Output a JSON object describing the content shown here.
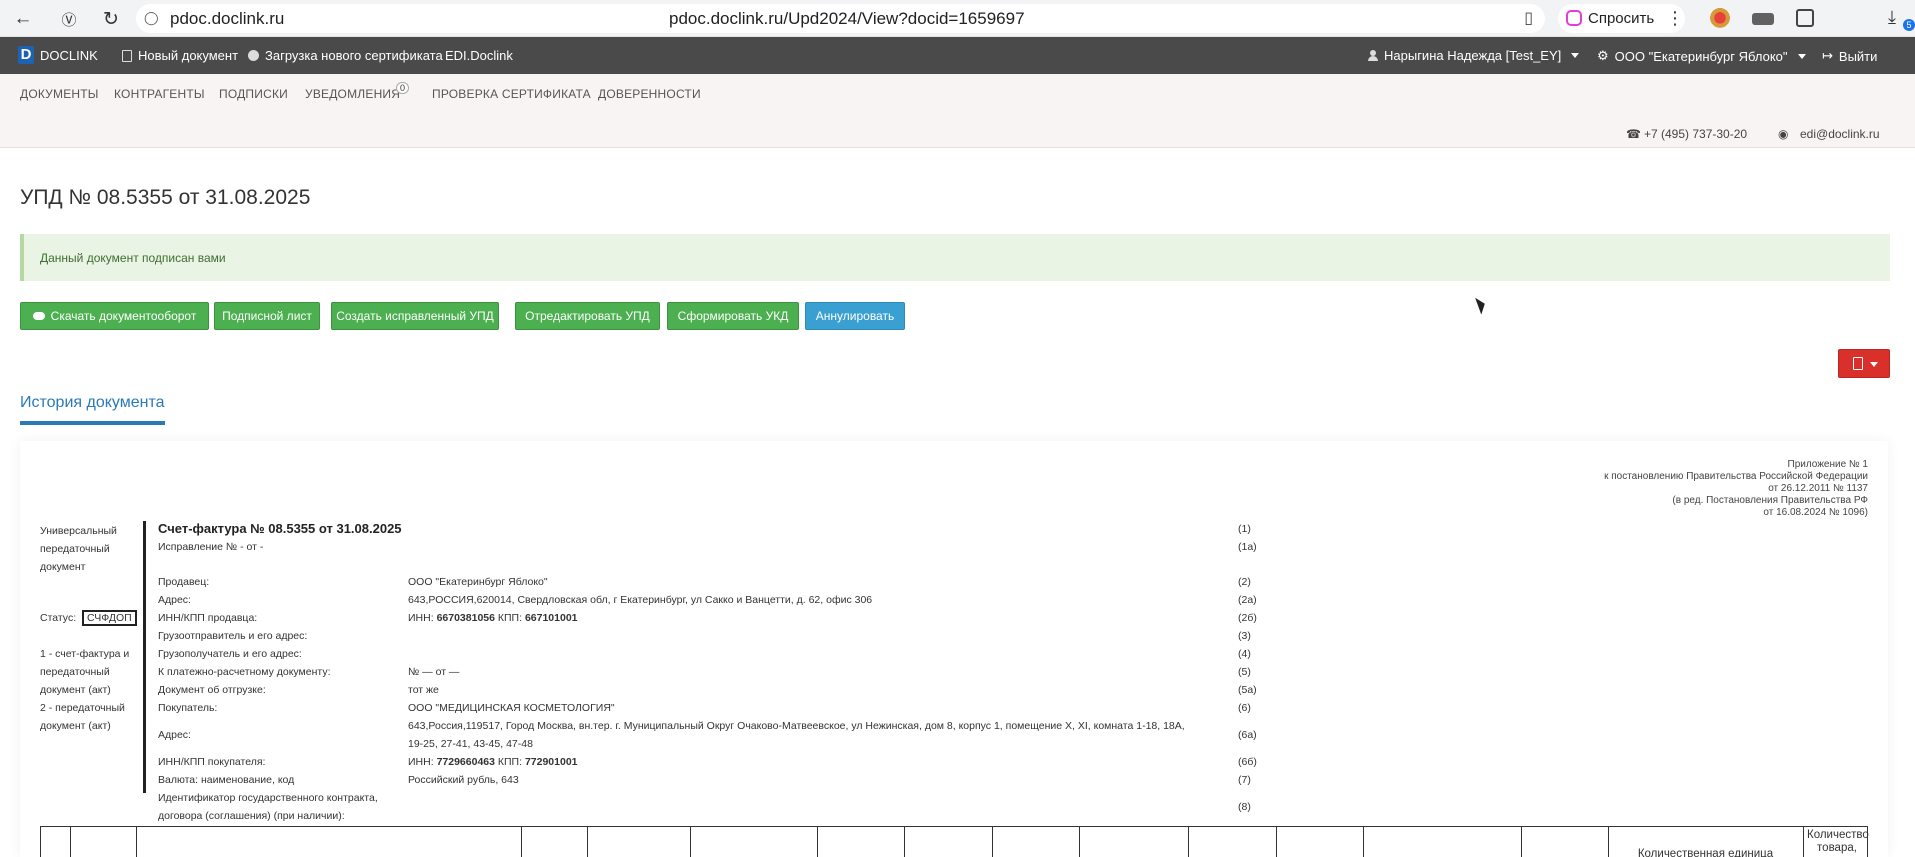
{
  "browser": {
    "host": "pdoc.doclink.ru",
    "url": "pdoc.doclink.ru/Upd2024/View?docid=1659697",
    "ask_label": "Спросить",
    "downloads_badge": "5"
  },
  "topbar": {
    "brand": "DOCLINK",
    "new_doc": "Новый документ",
    "upload_cert": "Загрузка нового сертификата",
    "edi": "EDI.Doclink",
    "user": "Нарыгина Надежда [Test_EY]",
    "org": "ООО \"Екатеринбург Яблоко\"",
    "logout": "Выйти"
  },
  "nav": {
    "items": [
      "ДОКУМЕНТЫ",
      "КОНТРАГЕНТЫ",
      "ПОДПИСКИ",
      "УВЕДОМЛЕНИЯ",
      "ПРОВЕРКА СЕРТИФИКАТА",
      "ДОВЕРЕННОСТИ"
    ],
    "notifications_count": "0",
    "phone": "+7 (495) 737-30-20",
    "email": "edi@doclink.ru"
  },
  "page": {
    "title": "УПД №   08.5355   от   31.08.2025",
    "alert": "Данный документ подписан вами",
    "history_tab": "История документа"
  },
  "actions": {
    "download": "Скачать документооборот",
    "sign_sheet": "Подписной лист",
    "create_corrected": "Создать исправленный УПД",
    "edit": "Отредактировать УПД",
    "form_ukd": "Сформировать УКД",
    "cancel": "Аннулировать"
  },
  "document": {
    "annex": [
      "Приложение № 1",
      "к постановлению Правительства Российской Федерации",
      "от 26.12.2011 № 1137",
      "(в ред. Постановления Правительства РФ",
      "от 16.08.2024 № 1096)"
    ],
    "left_title": "Универсальный передаточный документ",
    "status_label": "Статус:",
    "status_value": "СЧФДОП",
    "legend_1": "1 - счет-фактура и передаточный документ (акт)",
    "legend_2": "2 - передаточный документ (акт)",
    "invoice_title": "Счет-фактура № 08.5355  от 31.08.2025",
    "correction": "Исправление № - от -",
    "rows": {
      "seller_label": "Продавец:",
      "seller": "ООО \"Екатеринбург Яблоко\"",
      "address_label": "Адрес:",
      "seller_address": "643,РОССИЯ,620014, Свердловская обл, г Екатеринбург, ул Сакко и Ванцетти, д. 62, офис 306",
      "seller_inn_label": "ИНН/КПП продавца:",
      "inn_prefix": "ИНН:",
      "seller_inn": "6670381056",
      "kpp_prefix": "КПП:",
      "seller_kpp": "667101001",
      "consignor_label": "Грузоотправитель и его адрес:",
      "consignee_label": "Грузополучатель и его адрес:",
      "payment_label": "К платежно-расчетному документу:",
      "payment": "№   — от  —",
      "shipment_label": "Документ об отгрузке:",
      "shipment": "тот же",
      "buyer_label": "Покупатель:",
      "buyer": "ООО \"МЕДИЦИНСКАЯ КОСМЕТОЛОГИЯ\"",
      "buyer_address_1": "643,Россия,119517, Город Москва, вн.тер. г. Муниципальный Округ Очаково-Матвеевское, ул Нежинская, дом 8, корпус 1, помещение X, XI, комната 1-18, 18А,",
      "buyer_address_2": "19-25, 27-41, 43-45, 47-48",
      "buyer_inn_label": "ИНН/КПП покупателя:",
      "buyer_inn": "7729660463",
      "buyer_kpp": "772901001",
      "currency_label": "Валюта: наименование, код",
      "currency": "Российский рубль,  643",
      "contract_label_1": "Идентификатор государственного контракта,",
      "contract_label_2": "договора (соглашения) (при наличии):"
    },
    "codes": [
      "(1)",
      "(1а)",
      "(2)",
      "(2а)",
      "(2б)",
      "(3)",
      "(4)",
      "(5)",
      "(5а)",
      "(6)",
      "(6а)",
      "(6б)",
      "(7)",
      "(8)"
    ],
    "table_headers": {
      "unit": "Количественная единица",
      "qty_1": "Количество",
      "qty_2": "товара,"
    }
  }
}
